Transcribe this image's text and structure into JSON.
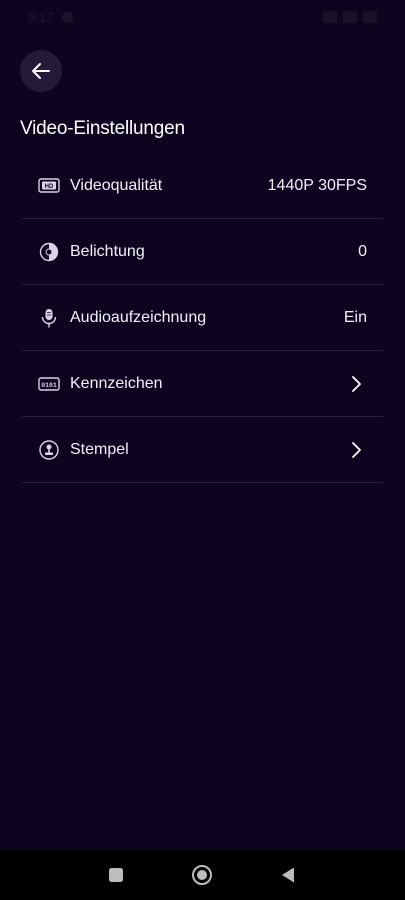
{
  "status_bar": {
    "time": "9:17"
  },
  "header": {
    "title": "Video-Einstellungen"
  },
  "settings": [
    {
      "label": "Videoqualität",
      "value": "1440P 30FPS",
      "icon": "hd-icon",
      "trailing": "value"
    },
    {
      "label": "Belichtung",
      "value": "0",
      "icon": "exposure-icon",
      "trailing": "value"
    },
    {
      "label": "Audioaufzeichnung",
      "value": "Ein",
      "icon": "microphone-icon",
      "trailing": "value"
    },
    {
      "label": "Kennzeichen",
      "value": "",
      "icon": "license-plate-icon",
      "trailing": "chevron"
    },
    {
      "label": "Stempel",
      "value": "",
      "icon": "stamp-icon",
      "trailing": "chevron"
    }
  ],
  "colors": {
    "background": "#0e0420",
    "back_button_bg": "#261a3a",
    "divider": "#2a2040",
    "text": "#f2f0f7",
    "nav_bar": "#000000"
  }
}
